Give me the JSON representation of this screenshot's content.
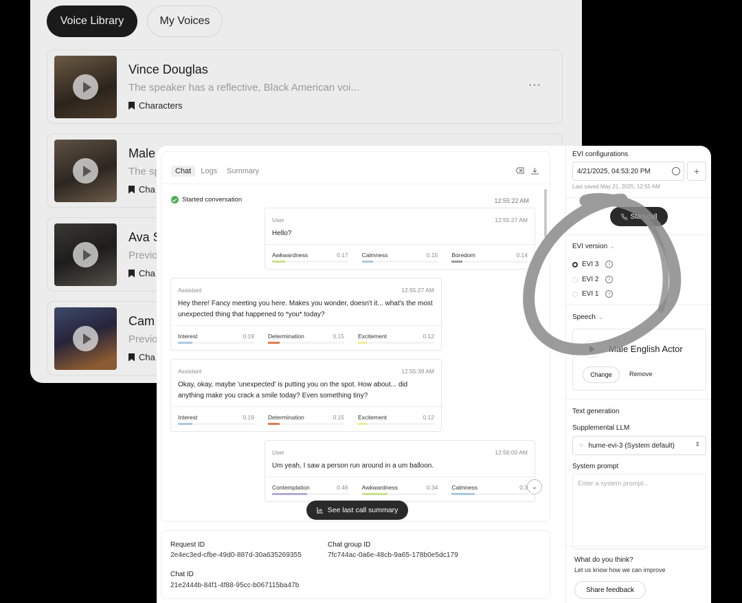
{
  "library": {
    "tabs": [
      {
        "label": "Voice Library",
        "active": true
      },
      {
        "label": "My Voices",
        "active": false
      }
    ],
    "voices": [
      {
        "name": "Vince Douglas",
        "description": "The speaker has a reflective, Black American voi...",
        "tag": "Characters"
      },
      {
        "name": "Male",
        "description": "The sp",
        "tag": "Cha"
      },
      {
        "name": "Ava S",
        "description": "Previo",
        "tag": "Cha"
      },
      {
        "name": "Cam",
        "description": "Previo",
        "tag": "Cha"
      }
    ],
    "more_label": "···"
  },
  "chat": {
    "tabs": [
      "Chat",
      "Logs",
      "Summary"
    ],
    "started": {
      "label": "Started conversation",
      "time": "12:55:22 AM"
    },
    "messages": [
      {
        "role": "User",
        "time": "12:55:27 AM",
        "text": "Hello?",
        "emotions": [
          {
            "name": "Awkwardness",
            "score": "0.17",
            "color": "#c9e08a"
          },
          {
            "name": "Calmness",
            "score": "0.15",
            "color": "#a9c8e2"
          },
          {
            "name": "Boredom",
            "score": "0.14",
            "color": "#9a9a9a"
          }
        ]
      },
      {
        "role": "Assistant",
        "time": "12:55:27 AM",
        "text": "Hey there! Fancy meeting you here. Makes you wonder, doesn't it... what's the most unexpected thing that happened to *you* today?",
        "emotions": [
          {
            "name": "Interest",
            "score": "0.19",
            "color": "#a9c8e2"
          },
          {
            "name": "Determination",
            "score": "0.15",
            "color": "#e07b4a"
          },
          {
            "name": "Excitement",
            "score": "0.12",
            "color": "#f1ea92"
          }
        ]
      },
      {
        "role": "Assistant",
        "time": "12:55:39 AM",
        "text": "Okay, okay, maybe 'unexpected' is putting you on the spot. How about... did anything make you crack a smile today? Even something tiny?",
        "emotions": [
          {
            "name": "Interest",
            "score": "0.19",
            "color": "#a9c8e2"
          },
          {
            "name": "Determination",
            "score": "0.15",
            "color": "#e07b4a"
          },
          {
            "name": "Excitement",
            "score": "0.12",
            "color": "#f1ea92"
          }
        ]
      },
      {
        "role": "User",
        "time": "12:56:00 AM",
        "text": "Um yeah, I saw a person run around in a um balloon.",
        "emotions": [
          {
            "name": "Contemplation",
            "score": "0.46",
            "color": "#b3a8dc"
          },
          {
            "name": "Awkwardness",
            "score": "0.34",
            "color": "#c9e08a"
          },
          {
            "name": "Calmness",
            "score": "0.3",
            "color": "#a9c8e2"
          }
        ]
      }
    ],
    "summary_button": "See last call summary"
  },
  "ids": {
    "request_label": "Request ID",
    "request_value": "2e4ec3ed-cfbe-49d0-887d-30a635269355",
    "group_label": "Chat group ID",
    "group_value": "7fc744ac-0a6e-48cb-9a65-178b0e5dc179",
    "chat_label": "Chat ID",
    "chat_value": "21e2444b-84f1-4f88-95cc-b067115ba47b"
  },
  "config": {
    "heading": "EVI configurations",
    "selected": "4/21/2025, 04:53:20 PM",
    "saved": "Last saved May 21, 2025, 12:55 AM",
    "start_call": "Start call",
    "version_heading": "EVI version",
    "versions": [
      {
        "label": "EVI 3",
        "selected": true
      },
      {
        "label": "EVI 2",
        "selected": false
      },
      {
        "label": "EVI 1",
        "selected": false
      }
    ],
    "speech_heading": "Speech",
    "voice_name": "Male English Actor",
    "change_label": "Change",
    "remove_label": "Remove",
    "textgen_heading": "Text generation",
    "llm_label": "Supplemental LLM",
    "llm_value": "hume-evi-3 (System default)",
    "prompt_label": "System prompt",
    "prompt_placeholder": "Enter a system prompt...",
    "feedback_title": "What do you think?",
    "feedback_sub": "Let us know how we can improve",
    "feedback_button": "Share feedback"
  }
}
